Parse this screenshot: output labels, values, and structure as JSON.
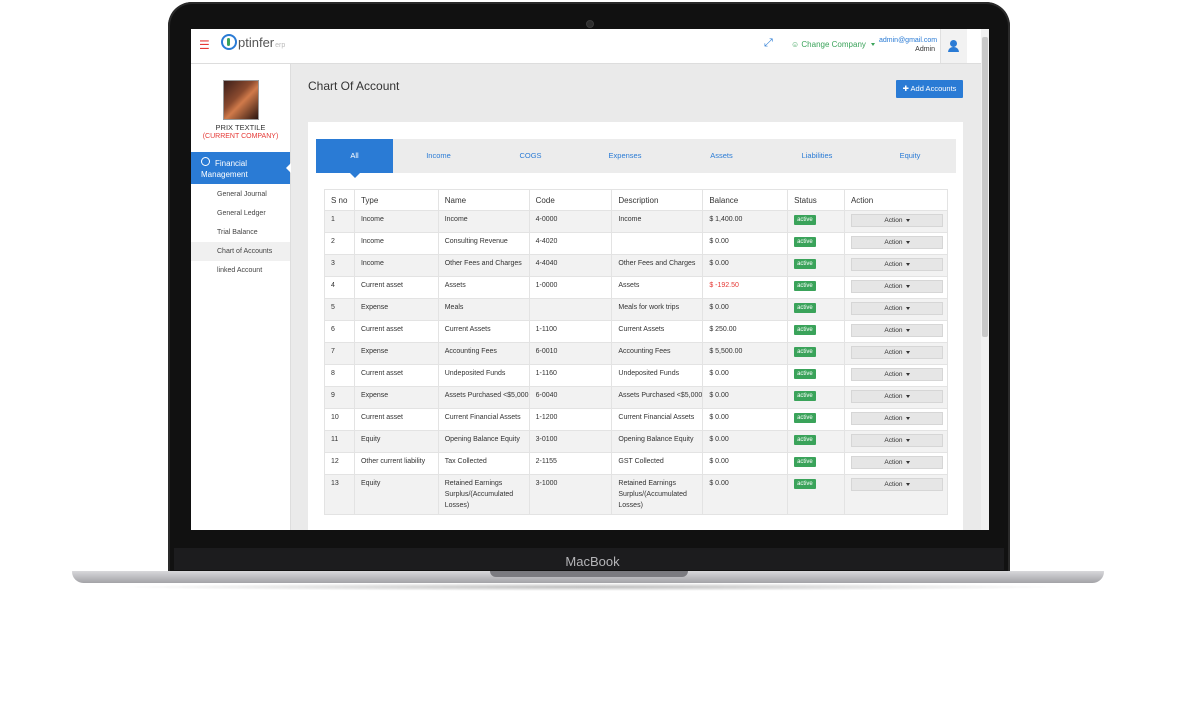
{
  "device": {
    "brand": "MacBook"
  },
  "header": {
    "logo_text": "ptinfer",
    "logo_suffix": "erp",
    "company_switch": "Change Company",
    "user_email": "admin@gmail.com",
    "user_role": "Admin",
    "icons": [
      "menu-icon",
      "expand-icon",
      "user-icon"
    ]
  },
  "sidebar": {
    "company_name": "PRIX TEXTILE",
    "company_note": "(CURRENT COMPANY)",
    "active_menu": "Financial Management",
    "sub_items": [
      "General Journal",
      "General Ledger",
      "Trial Balance",
      "Chart of Accounts",
      "linked Account"
    ],
    "selected_sub": "Chart of Accounts"
  },
  "main": {
    "title": "Chart Of Account",
    "add_button": "Add Accounts",
    "tabs": [
      "All",
      "Income",
      "COGS",
      "Expenses",
      "Assets",
      "Liabilities",
      "Equity"
    ],
    "active_tab": "All",
    "columns": [
      "S no",
      "Type",
      "Name",
      "Code",
      "Description",
      "Balance",
      "Status",
      "Action"
    ],
    "rows": [
      {
        "sno": "1",
        "type": "Income",
        "name": "Income",
        "code": "4-0000",
        "desc": "Income",
        "balance": "$ 1,400.00",
        "status": "active",
        "action": "Action"
      },
      {
        "sno": "2",
        "type": "Income",
        "name": "Consulting Revenue",
        "code": "4-4020",
        "desc": "",
        "balance": "$ 0.00",
        "status": "active",
        "action": "Action"
      },
      {
        "sno": "3",
        "type": "Income",
        "name": "Other Fees and Charges",
        "code": "4-4040",
        "desc": "Other Fees and Charges",
        "balance": "$ 0.00",
        "status": "active",
        "action": "Action"
      },
      {
        "sno": "4",
        "type": "Current asset",
        "name": "Assets",
        "code": "1-0000",
        "desc": "Assets",
        "balance": "$ -192.50",
        "status": "active",
        "action": "Action"
      },
      {
        "sno": "5",
        "type": "Expense",
        "name": "Meals",
        "code": "",
        "desc": "Meals for work trips",
        "balance": "$ 0.00",
        "status": "active",
        "action": "Action"
      },
      {
        "sno": "6",
        "type": "Current asset",
        "name": "Current Assets",
        "code": "1-1100",
        "desc": "Current Assets",
        "balance": "$ 250.00",
        "status": "active",
        "action": "Action"
      },
      {
        "sno": "7",
        "type": "Expense",
        "name": "Accounting Fees",
        "code": "6-0010",
        "desc": "Accounting Fees",
        "balance": "$ 5,500.00",
        "status": "active",
        "action": "Action"
      },
      {
        "sno": "8",
        "type": "Current asset",
        "name": "Undeposited Funds",
        "code": "1-1160",
        "desc": "Undeposited Funds",
        "balance": "$ 0.00",
        "status": "active",
        "action": "Action"
      },
      {
        "sno": "9",
        "type": "Expense",
        "name": "Assets Purchased <$5,000",
        "code": "6-0040",
        "desc": "Assets Purchased <$5,000",
        "balance": "$ 0.00",
        "status": "active",
        "action": "Action"
      },
      {
        "sno": "10",
        "type": "Current asset",
        "name": "Current Financial Assets",
        "code": "1-1200",
        "desc": "Current Financial Assets",
        "balance": "$ 0.00",
        "status": "active",
        "action": "Action"
      },
      {
        "sno": "11",
        "type": "Equity",
        "name": "Opening Balance Equity",
        "code": "3-0100",
        "desc": "Opening Balance Equity",
        "balance": "$ 0.00",
        "status": "active",
        "action": "Action"
      },
      {
        "sno": "12",
        "type": "Other current liability",
        "name": "Tax Collected",
        "code": "2-1155",
        "desc": "GST Collected",
        "balance": "$ 0.00",
        "status": "active",
        "action": "Action"
      },
      {
        "sno": "13",
        "type": "Equity",
        "name": "Retained Earnings Surplus/(Accumulated Losses)",
        "code": "3-1000",
        "desc": "Retained Earnings Surplus/(Accumulated Losses)",
        "balance": "$ 0.00",
        "status": "active",
        "action": "Action"
      }
    ]
  },
  "colors": {
    "accent": "#2a7bd5",
    "active_badge": "#3aa35a",
    "negative": "#e53935",
    "menu_icon": "#e53935"
  }
}
